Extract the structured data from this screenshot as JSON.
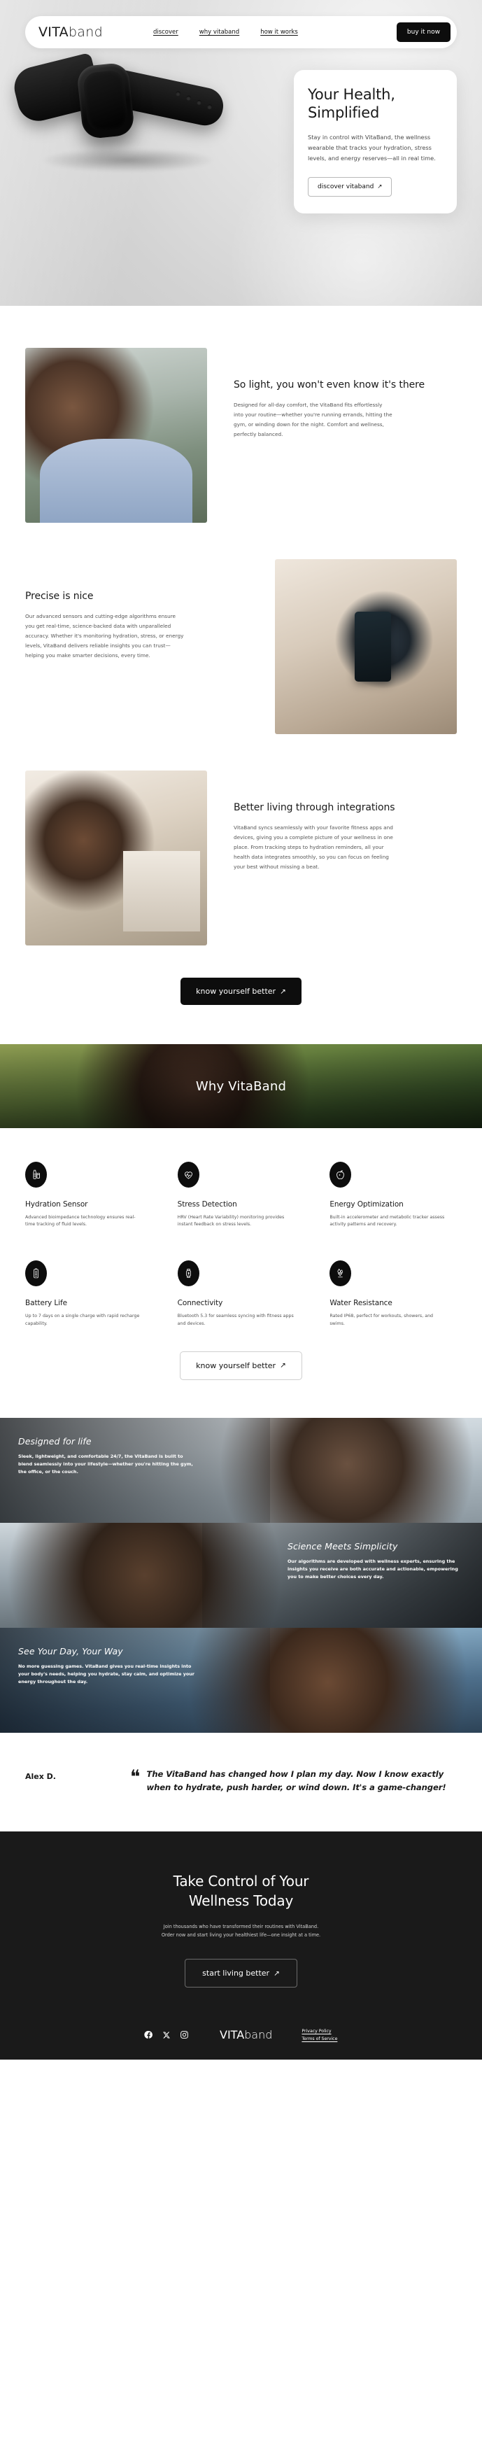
{
  "nav": {
    "logo_a": "VITA",
    "logo_b": "band",
    "links": [
      {
        "label": "discover"
      },
      {
        "label": "why vitaband"
      },
      {
        "label": "how it works"
      }
    ],
    "cta": "buy it now"
  },
  "hero": {
    "title_line1": "Your Health,",
    "title_line2": "Simplified",
    "body": "Stay in control with VitaBand, the wellness wearable that tracks your hydration, stress levels, and energy reserves—all in real time.",
    "cta": "discover vitaband",
    "cta_arrow": "↗"
  },
  "sections": [
    {
      "heading": "So light, you won't even know it's there",
      "body": "Designed for all-day comfort, the VitaBand fits effortlessly into your routine—whether you're running errands, hitting the gym, or winding down for the night. Comfort and wellness, perfectly balanced.",
      "image_name": "woman-checking-band-outdoors"
    },
    {
      "heading": "Precise is nice",
      "body": "Our advanced sensors and cutting-edge algorithms ensure you get real-time, science-backed data with unparalleled accuracy. Whether it's monitoring hydration, stress, or energy levels, VitaBand delivers reliable insights you can trust—helping you make smarter decisions, every time.",
      "image_name": "hands-holding-phone-with-app"
    },
    {
      "heading": "Better living through integrations",
      "body": "VitaBand syncs seamlessly with your favorite fitness apps and devices, giving you a complete picture of your wellness in one place. From tracking steps to hydration reminders, all your health data integrates smoothly, so you can focus on feeling your best without missing a beat.",
      "image_name": "woman-in-kitchen-with-phone"
    }
  ],
  "mid_cta": {
    "label": "know yourself better",
    "arrow": "↗"
  },
  "why": {
    "title": "Why VitaBand"
  },
  "features": [
    {
      "icon": "water-bottle-icon",
      "title": "Hydration Sensor",
      "body": "Advanced bioimpedance technology ensures real-time tracking of fluid levels."
    },
    {
      "icon": "heart-pulse-icon",
      "title": "Stress Detection",
      "body": "HRV (Heart Rate Variability) monitoring provides instant feedback on stress levels."
    },
    {
      "icon": "apple-health-icon",
      "title": "Energy Optimization",
      "body": "Built-in accelerometer and metabolic tracker assess activity patterns and recovery."
    },
    {
      "icon": "battery-icon",
      "title": "Battery Life",
      "body": "Up to 7 days on a single charge with rapid recharge capability."
    },
    {
      "icon": "smartwatch-bluetooth-icon",
      "title": "Connectivity",
      "body": "Bluetooth 5.3 for seamless syncing with fitness apps and devices."
    },
    {
      "icon": "water-drop-icon",
      "title": "Water Resistance",
      "body": "Rated IP68, perfect for workouts, showers, and swims."
    }
  ],
  "features_cta": {
    "label": "know yourself better",
    "arrow": "↗"
  },
  "panels": [
    {
      "heading": "Designed for life",
      "body": "Sleek, lightweight, and comfortable 24/7, the VitaBand is built to blend seamlessly into your lifestyle—whether you're hitting the gym, the office, or the couch.",
      "align": "left",
      "image_name": "man-in-office-wearing-band"
    },
    {
      "heading": "Science Meets Simplicity",
      "body": "Our algorithms are developed with wellness experts, ensuring the insights you receive are both accurate and actionable, empowering you to make better choices every day.",
      "align": "right",
      "image_name": "people-training-outdoors"
    },
    {
      "heading": "See Your Day, Your Way",
      "body": "No more guessing games. VitaBand gives you real-time insights into your body's needs, helping you hydrate, stay calm, and optimize your energy throughout the day.",
      "align": "left",
      "image_name": "runner-at-the-beach"
    }
  ],
  "testimonial": {
    "author": "Alex D.",
    "quote_mark": "❝",
    "quote": "The VitaBand has changed how I plan my day. Now I know exactly when to hydrate, push harder, or wind down. It's a game-changer!"
  },
  "final_cta": {
    "title_line1": "Take Control of Your",
    "title_line2": "Wellness Today",
    "body_line1": "Join thousands who have transformed their routines with VitaBand.",
    "body_line2": "Order now and start living your healthiest life—one insight at a time.",
    "button": "start living better",
    "arrow": "↗"
  },
  "footer": {
    "socials": [
      {
        "name": "facebook-icon"
      },
      {
        "name": "x-twitter-icon"
      },
      {
        "name": "instagram-icon"
      }
    ],
    "logo_a": "VITA",
    "logo_b": "band",
    "links": [
      {
        "label": "Privacy Policy"
      },
      {
        "label": "Terms of Service"
      }
    ]
  }
}
